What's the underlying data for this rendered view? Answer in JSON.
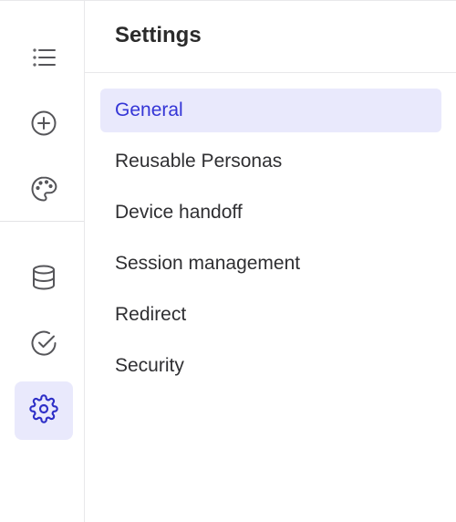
{
  "rail": {
    "items": [
      {
        "icon": "list-icon",
        "active": false
      },
      {
        "icon": "plus-circle-icon",
        "active": false
      },
      {
        "icon": "palette-icon",
        "active": false
      },
      {
        "icon": "database-icon",
        "active": false
      },
      {
        "icon": "check-circle-icon",
        "active": false
      },
      {
        "icon": "gear-icon",
        "active": true
      }
    ]
  },
  "settings": {
    "title": "Settings",
    "items": [
      {
        "label": "General",
        "active": true
      },
      {
        "label": "Reusable Personas",
        "active": false
      },
      {
        "label": "Device handoff",
        "active": false
      },
      {
        "label": "Session management",
        "active": false
      },
      {
        "label": "Redirect",
        "active": false
      },
      {
        "label": "Security",
        "active": false
      }
    ]
  },
  "colors": {
    "accent": "#3435d6",
    "accent_bg": "#e9e9fc",
    "border": "#e8e8ea",
    "text": "#2b2b2b",
    "icon": "#555559"
  }
}
